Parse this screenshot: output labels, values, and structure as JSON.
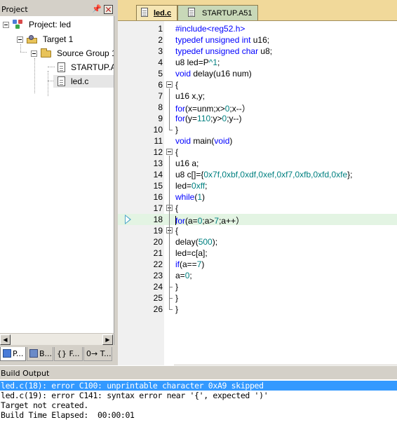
{
  "colors": {
    "keyword": "#0000ff",
    "number": "#008080",
    "text": "#000000",
    "current_line": "#e3f4e3",
    "editor_bg": "#f1d99a",
    "selection": "#3399ff"
  },
  "project_panel": {
    "title": "Project",
    "pin_icon": "I",
    "tree": [
      {
        "label": "Project: led",
        "icon": "project-icon"
      },
      {
        "label": "Target 1",
        "icon": "target-icon"
      },
      {
        "label": "Source Group 1",
        "icon": "folder-icon"
      },
      {
        "label": "STARTUP.A51",
        "icon": "file-icon"
      },
      {
        "label": "led.c",
        "icon": "file-icon"
      }
    ],
    "tabs": [
      {
        "label": "P...",
        "icon": "project-tab-icon"
      },
      {
        "label": "B...",
        "icon": "books-tab-icon"
      },
      {
        "label": "{} F...",
        "icon": "functions-tab-icon"
      },
      {
        "label": "0→ T...",
        "icon": "templates-tab-icon"
      }
    ]
  },
  "editor": {
    "tabs": [
      {
        "label": "led.c",
        "active": true
      },
      {
        "label": "STARTUP.A51",
        "active": false
      }
    ],
    "current_line": 18,
    "lines": [
      {
        "n": "1",
        "tokens": [
          {
            "t": "#include<reg52.h>",
            "c": "keyword"
          }
        ]
      },
      {
        "n": "2",
        "tokens": [
          {
            "t": "typedef unsigned int",
            "c": "keyword"
          },
          {
            "t": " u16;",
            "c": "text"
          }
        ]
      },
      {
        "n": "3",
        "tokens": [
          {
            "t": "typedef unsigned char",
            "c": "keyword"
          },
          {
            "t": " u8;",
            "c": "text"
          }
        ]
      },
      {
        "n": "4",
        "tokens": [
          {
            "t": "u8 led=P",
            "c": "text"
          },
          {
            "t": "^1",
            "c": "number"
          },
          {
            "t": ";",
            "c": "text"
          }
        ]
      },
      {
        "n": "5",
        "tokens": [
          {
            "t": "void",
            "c": "keyword"
          },
          {
            "t": " delay(u16 num)",
            "c": "text"
          }
        ]
      },
      {
        "n": "6",
        "tokens": [
          {
            "t": "{",
            "c": "text"
          }
        ]
      },
      {
        "n": "7",
        "tokens": [
          {
            "t": "u16 x,y;",
            "c": "text"
          }
        ]
      },
      {
        "n": "8",
        "tokens": [
          {
            "t": "for",
            "c": "keyword"
          },
          {
            "t": "(x=unm;x>",
            "c": "text"
          },
          {
            "t": "0",
            "c": "number"
          },
          {
            "t": ";x--）",
            "c": "text"
          }
        ]
      },
      {
        "n": "9",
        "tokens": [
          {
            "t": "for",
            "c": "keyword"
          },
          {
            "t": "(y=",
            "c": "text"
          },
          {
            "t": "110",
            "c": "number"
          },
          {
            "t": ";y>",
            "c": "text"
          },
          {
            "t": "0",
            "c": "number"
          },
          {
            "t": ";y--)",
            "c": "text"
          }
        ]
      },
      {
        "n": "10",
        "tokens": [
          {
            "t": "}",
            "c": "text"
          }
        ]
      },
      {
        "n": "11",
        "tokens": [
          {
            "t": "void",
            "c": "keyword"
          },
          {
            "t": " main(",
            "c": "text"
          },
          {
            "t": "void",
            "c": "keyword"
          },
          {
            "t": ")",
            "c": "text"
          }
        ]
      },
      {
        "n": "12",
        "tokens": [
          {
            "t": "{",
            "c": "text"
          }
        ]
      },
      {
        "n": "13",
        "tokens": [
          {
            "t": "u16 a;",
            "c": "text"
          }
        ]
      },
      {
        "n": "14",
        "tokens": [
          {
            "t": "u8 c[]={",
            "c": "text"
          },
          {
            "t": "0x7f,0xbf,0xdf,0xef,0xf7,0xfb,0xfd,0xfe",
            "c": "number"
          },
          {
            "t": "};",
            "c": "text"
          }
        ]
      },
      {
        "n": "15",
        "tokens": [
          {
            "t": "led=",
            "c": "text"
          },
          {
            "t": "0xff",
            "c": "number"
          },
          {
            "t": ";",
            "c": "text"
          }
        ]
      },
      {
        "n": "16",
        "tokens": [
          {
            "t": "while",
            "c": "keyword"
          },
          {
            "t": "(",
            "c": "text"
          },
          {
            "t": "1",
            "c": "number"
          },
          {
            "t": ")",
            "c": "text"
          }
        ]
      },
      {
        "n": "17",
        "tokens": [
          {
            "t": "{",
            "c": "text"
          }
        ]
      },
      {
        "n": "18",
        "tokens": [
          {
            "t": "for",
            "c": "keyword"
          },
          {
            "t": "(a=",
            "c": "text"
          },
          {
            "t": "0",
            "c": "number"
          },
          {
            "t": ";a>",
            "c": "text"
          },
          {
            "t": "7",
            "c": "number"
          },
          {
            "t": ";a++）",
            "c": "text"
          }
        ]
      },
      {
        "n": "19",
        "tokens": [
          {
            "t": "{",
            "c": "text"
          }
        ]
      },
      {
        "n": "20",
        "tokens": [
          {
            "t": "delay(",
            "c": "text"
          },
          {
            "t": "500",
            "c": "number"
          },
          {
            "t": ");",
            "c": "text"
          }
        ]
      },
      {
        "n": "21",
        "tokens": [
          {
            "t": "led=c[a];",
            "c": "text"
          }
        ]
      },
      {
        "n": "22",
        "tokens": [
          {
            "t": "if",
            "c": "keyword"
          },
          {
            "t": "(a==",
            "c": "text"
          },
          {
            "t": "7",
            "c": "number"
          },
          {
            "t": ")",
            "c": "text"
          }
        ]
      },
      {
        "n": "23",
        "tokens": [
          {
            "t": "a=",
            "c": "text"
          },
          {
            "t": "0",
            "c": "number"
          },
          {
            "t": ";",
            "c": "text"
          }
        ]
      },
      {
        "n": "24",
        "tokens": [
          {
            "t": "}",
            "c": "text"
          }
        ]
      },
      {
        "n": "25",
        "tokens": [
          {
            "t": "}",
            "c": "text"
          }
        ]
      },
      {
        "n": "26",
        "tokens": [
          {
            "t": "}",
            "c": "text"
          }
        ]
      }
    ]
  },
  "build_output": {
    "title": "Build Output",
    "lines": [
      {
        "text": "led.c(18): error C100: unprintable character 0xA9 skipped",
        "selected": true
      },
      {
        "text": "led.c(19): error C141: syntax error near '{', expected ')'",
        "selected": false
      },
      {
        "text": "Target not created.",
        "selected": false
      },
      {
        "text": "Build Time Elapsed:  00:00:01",
        "selected": false
      }
    ]
  }
}
